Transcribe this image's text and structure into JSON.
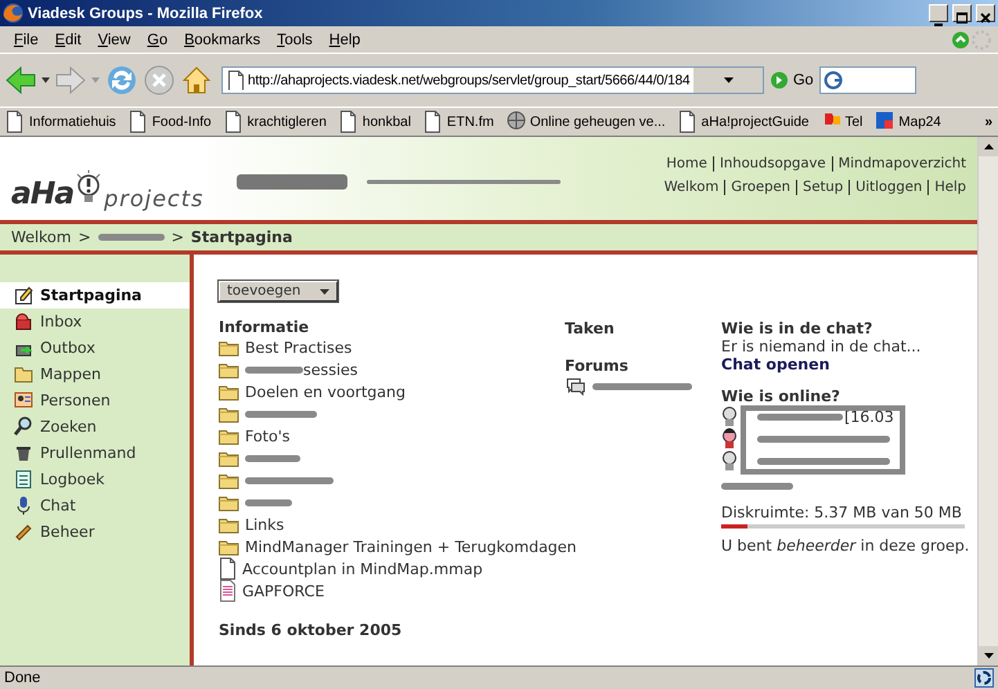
{
  "window": {
    "title": "Viadesk Groups - Mozilla Firefox"
  },
  "menu": [
    "File",
    "Edit",
    "View",
    "Go",
    "Bookmarks",
    "Tools",
    "Help"
  ],
  "toolbar": {
    "address": "http://ahaprojects.viadesk.net/webgroups/servlet/group_start/5666/44/0/184",
    "go": "Go"
  },
  "bookmarks": [
    {
      "kind": "page",
      "label": "Informatiehuis"
    },
    {
      "kind": "page",
      "label": "Food-Info"
    },
    {
      "kind": "page",
      "label": "krachtigleren"
    },
    {
      "kind": "page",
      "label": "honkbal"
    },
    {
      "kind": "page",
      "label": "ETN.fm"
    },
    {
      "kind": "globe",
      "label": "Online geheugen ve..."
    },
    {
      "kind": "page",
      "label": "aHa!projectGuide"
    },
    {
      "kind": "flag",
      "label": "Tel"
    },
    {
      "kind": "map",
      "label": "Map24"
    }
  ],
  "bookmarks_more": "»",
  "header": {
    "logo_main": "aHa",
    "logo_sub": "projects",
    "top_links": [
      "Home",
      "Inhoudsopgave",
      "Mindmapoverzicht"
    ],
    "bottom_links": [
      "Welkom",
      "Groepen",
      "Setup",
      "Uitloggen",
      "Help"
    ]
  },
  "breadcrumb": [
    {
      "kind": "link",
      "text": "Welkom"
    },
    {
      "kind": "sep",
      "text": ">"
    },
    {
      "kind": "redacted"
    },
    {
      "kind": "sep",
      "text": ">"
    },
    {
      "kind": "current",
      "text": "Startpagina"
    }
  ],
  "sidebar": {
    "items": [
      {
        "label": "Startpagina",
        "selected": true
      },
      {
        "label": "Inbox",
        "selected": false
      },
      {
        "label": "Outbox",
        "selected": false
      },
      {
        "label": "Mappen",
        "selected": false
      },
      {
        "label": "Personen",
        "selected": false
      },
      {
        "label": "Zoeken",
        "selected": false
      },
      {
        "label": "Prullenmand",
        "selected": false
      },
      {
        "label": "Logboek",
        "selected": false
      },
      {
        "label": "Chat",
        "selected": false
      },
      {
        "label": "Beheer",
        "selected": false
      }
    ]
  },
  "add_dropdown": {
    "value": "toevoegen"
  },
  "informatie": {
    "title": "Informatie",
    "items": [
      {
        "kind": "folder",
        "text": "Best Practises"
      },
      {
        "kind": "folder",
        "redacted": true,
        "text": "sessies"
      },
      {
        "kind": "folder",
        "text": "Doelen en voortgang"
      },
      {
        "kind": "folder",
        "redacted": true
      },
      {
        "kind": "folder",
        "text": "Foto's"
      },
      {
        "kind": "folder",
        "redacted": true
      },
      {
        "kind": "folder",
        "redacted": true
      },
      {
        "kind": "folder",
        "redacted": true
      },
      {
        "kind": "folder",
        "text": "Links"
      },
      {
        "kind": "folder",
        "text": "MindManager Trainingen + Terugkomdagen"
      },
      {
        "kind": "file",
        "text": "Accountplan in MindMap.mmap"
      },
      {
        "kind": "document",
        "text": "GAPFORCE"
      }
    ]
  },
  "since": "Sinds 6 oktober 2005",
  "tasks": {
    "title": "Taken"
  },
  "forums": {
    "title": "Forums",
    "items": [
      {
        "redacted": true
      }
    ]
  },
  "chat": {
    "title": "Wie is in de chat?",
    "status": "Er is niemand in de chat...",
    "link": "Chat openen"
  },
  "online": {
    "title": "Wie is online?",
    "users": [
      {
        "active": false,
        "text": "[16.03"
      },
      {
        "active": true
      },
      {
        "active": false
      }
    ]
  },
  "disk": {
    "text": "Diskruimte: 5.37 MB van 50 MB",
    "level": 0.107
  },
  "role": "U bent *beheerder* in deze groep.",
  "status_bar": {
    "text": "Done"
  }
}
